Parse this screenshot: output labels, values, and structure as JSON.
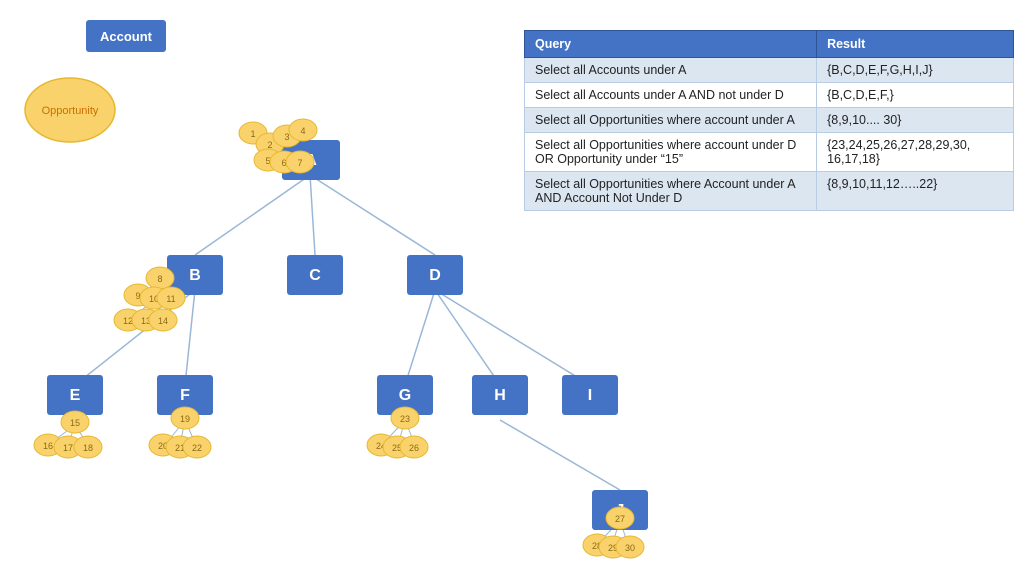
{
  "legend": {
    "account_label": "Account",
    "opportunity_label": "Opportunity"
  },
  "table": {
    "headers": [
      "Query",
      "Result"
    ],
    "rows": [
      {
        "query": "Select all Accounts under A",
        "result": "{B,C,D,E,F,G,H,I,J}"
      },
      {
        "query": "Select all Accounts under A AND not under D",
        "result": "{B,C,D,E,F,}"
      },
      {
        "query": "Select all Opportunities where account under A",
        "result": "{8,9,10.... 30}"
      },
      {
        "query": "Select all Opportunities where account under D OR Opportunity under “15”",
        "result": "{23,24,25,26,27,28,29,30, 16,17,18}"
      },
      {
        "query": "Select all Opportunities where Account under A AND Account Not Under D",
        "result": "{8,9,10,11,12…..22}"
      }
    ]
  },
  "nodes": {
    "accounts": [
      "A",
      "B",
      "C",
      "D",
      "E",
      "F",
      "G",
      "H",
      "I",
      "J"
    ],
    "opportunities": [
      1,
      2,
      3,
      4,
      5,
      6,
      7,
      8,
      9,
      10,
      11,
      12,
      13,
      14,
      15,
      16,
      17,
      18,
      19,
      20,
      21,
      22,
      23,
      24,
      25,
      26,
      27,
      28,
      29,
      30
    ]
  },
  "colors": {
    "account_fill": "#4472C4",
    "account_text": "#ffffff",
    "opportunity_fill": "#FAD26B",
    "opportunity_stroke": "#e6b830",
    "line_color": "#9ab7d6"
  }
}
